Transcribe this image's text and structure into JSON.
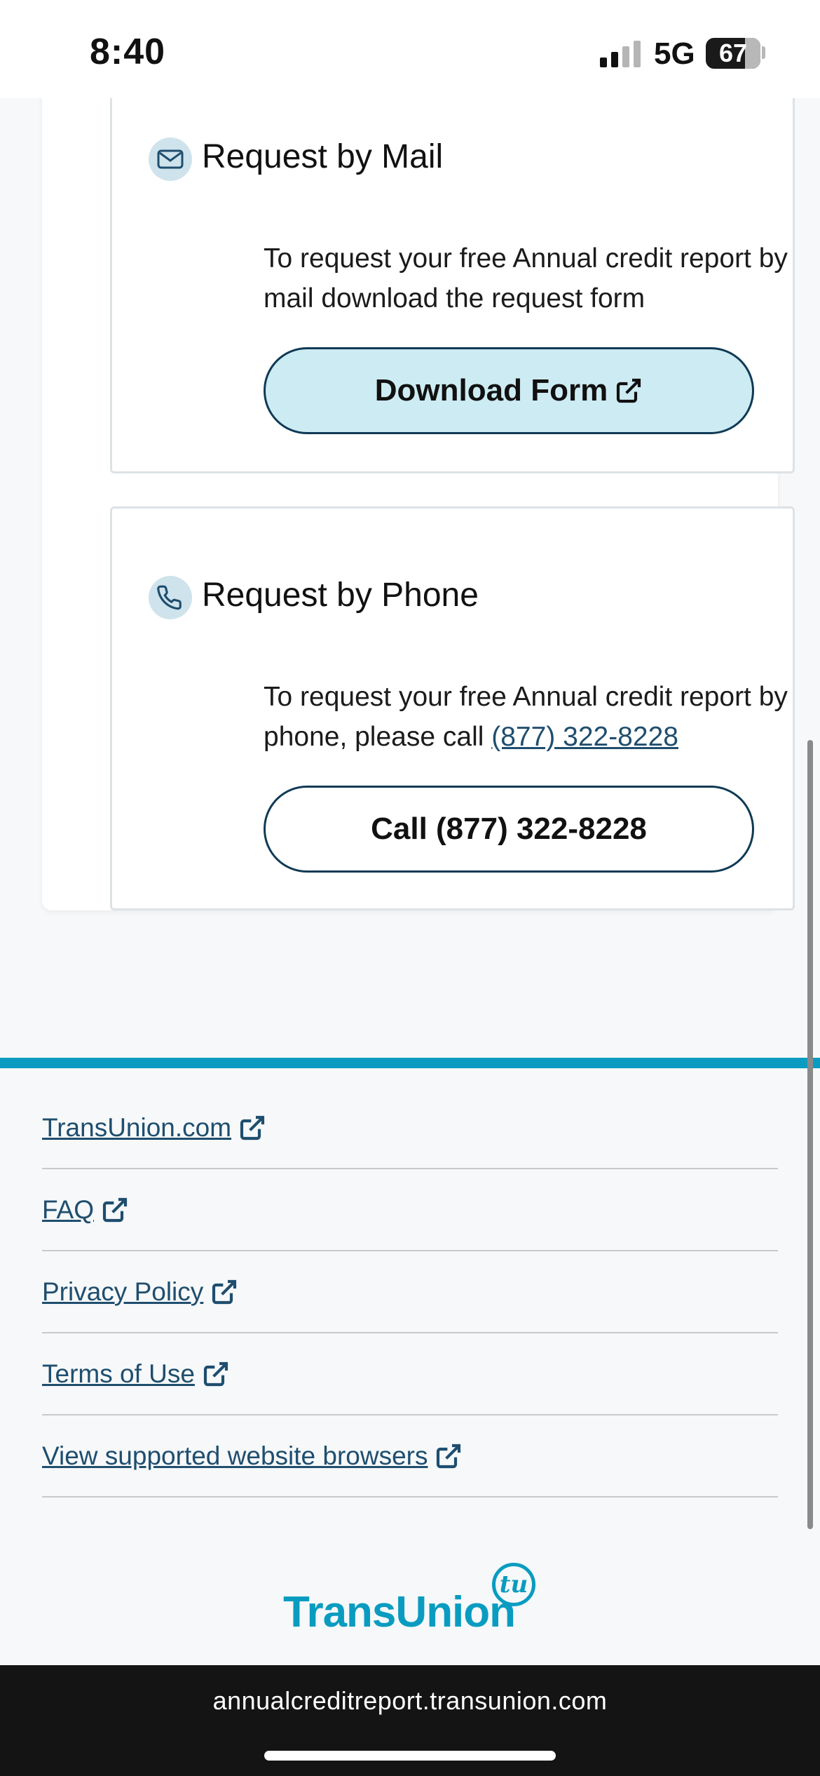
{
  "status_bar": {
    "time": "8:40",
    "network": "5G",
    "battery": "67"
  },
  "mail_card": {
    "title": "Request by Mail",
    "icon": "envelope-icon",
    "text": "To request your free Annual credit report by mail download the request form",
    "button_label": "Download Form"
  },
  "phone_card": {
    "title": "Request by Phone",
    "icon": "phone-icon",
    "text_prefix": "To request your free Annual credit report by phone, please call ",
    "phone_link": "(877) 322-8228",
    "button_label": "Call (877) 322-8228"
  },
  "footer_links": [
    {
      "label": "TransUnion.com"
    },
    {
      "label": "FAQ"
    },
    {
      "label": "Privacy Policy"
    },
    {
      "label": "Terms of Use"
    },
    {
      "label": "View supported website browsers"
    }
  ],
  "logo": {
    "text": "TransUnion",
    "mark": "tu"
  },
  "browser": {
    "url": "annualcreditreport.transunion.com"
  },
  "colors": {
    "accent": "#0a9cc0",
    "link": "#1f4e6e",
    "button_fill": "#cdebf2",
    "button_border": "#0f3a55"
  }
}
